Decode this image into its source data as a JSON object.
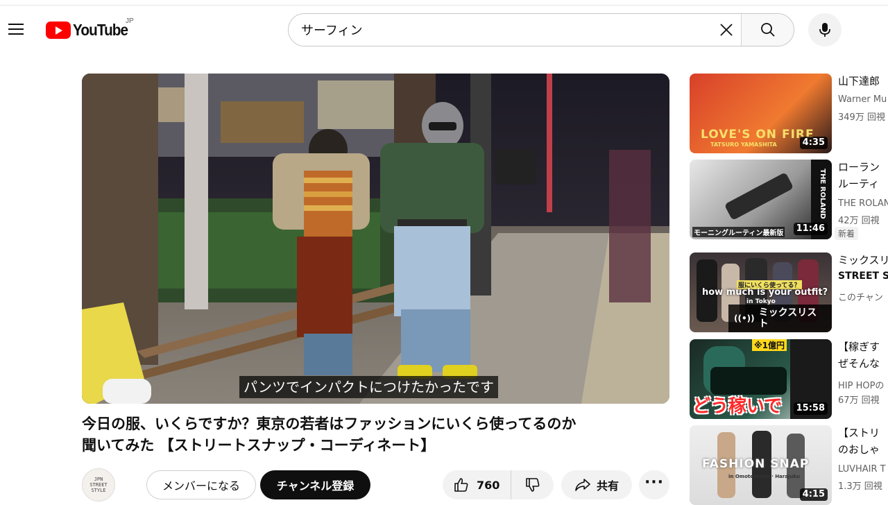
{
  "header": {
    "logo_text": "YouTube",
    "region": "JP",
    "search_value": "サーフィン"
  },
  "player": {
    "subtitle": "パンツでインパクトにつけたかったです"
  },
  "video": {
    "title_line1": "今日の服、いくらですか？東京の若者はファッションにいくら使ってるのか",
    "title_line2": "聞いてみた 【ストリートスナップ・コーディネート】",
    "channel_avatar_line1": "JPN",
    "channel_avatar_line2": "STREET",
    "channel_avatar_line3": "STYLE",
    "member_label": "メンバーになる",
    "subscribe_label": "チャンネル登録",
    "like_count": "760",
    "share_label": "共有",
    "more_label": "···"
  },
  "recommendations": [
    {
      "title": "山下達郎",
      "channel": "Warner Mu",
      "meta": "349万 回視",
      "duration": "4:35",
      "thumb_text": "LOVE'S ON FIRE",
      "thumb_sub": "TATSURO YAMASHITA"
    },
    {
      "title": "ローラン",
      "title2": "ルーティ",
      "channel": "THE ROLAN",
      "meta": "42万 回視",
      "badge": "新着",
      "duration": "11:46",
      "thumb_text": "モーニングルーティン最新版",
      "thumb_side": "THE ROLAND"
    },
    {
      "title": "ミックスリ",
      "channel": "STREET S",
      "meta": "このチャン",
      "duration": "ミックスリスト",
      "thumb_text": "how much is your outfit?",
      "thumb_sub": "in Tokyo",
      "thumb_top": "服にいくら使ってる？"
    },
    {
      "title": "【稼ぎす",
      "title2": "ぜそんな",
      "channel": "HIP HOPの",
      "meta": "67万 回視",
      "duration": "15:58",
      "thumb_text": "どう稼いで",
      "thumb_top": "※1億円"
    },
    {
      "title": "【ストリ",
      "title2": "のおしゃ",
      "channel": "LUVHAIR T",
      "meta": "1.3万 回視",
      "duration": "4:15",
      "thumb_text": "FASHION SNAP",
      "thumb_sub": "in Omotesando · Harajuku"
    }
  ],
  "colors": {
    "brand_red": "#ff0000",
    "subscribe_bg": "#0f0f0f",
    "chip_bg": "#f2f2f2"
  },
  "icons": [
    "menu-icon",
    "youtube-play-icon",
    "clear-icon",
    "search-icon",
    "mic-icon",
    "thumbs-up-icon",
    "thumbs-down-icon",
    "share-icon",
    "more-icon",
    "radio-icon"
  ]
}
